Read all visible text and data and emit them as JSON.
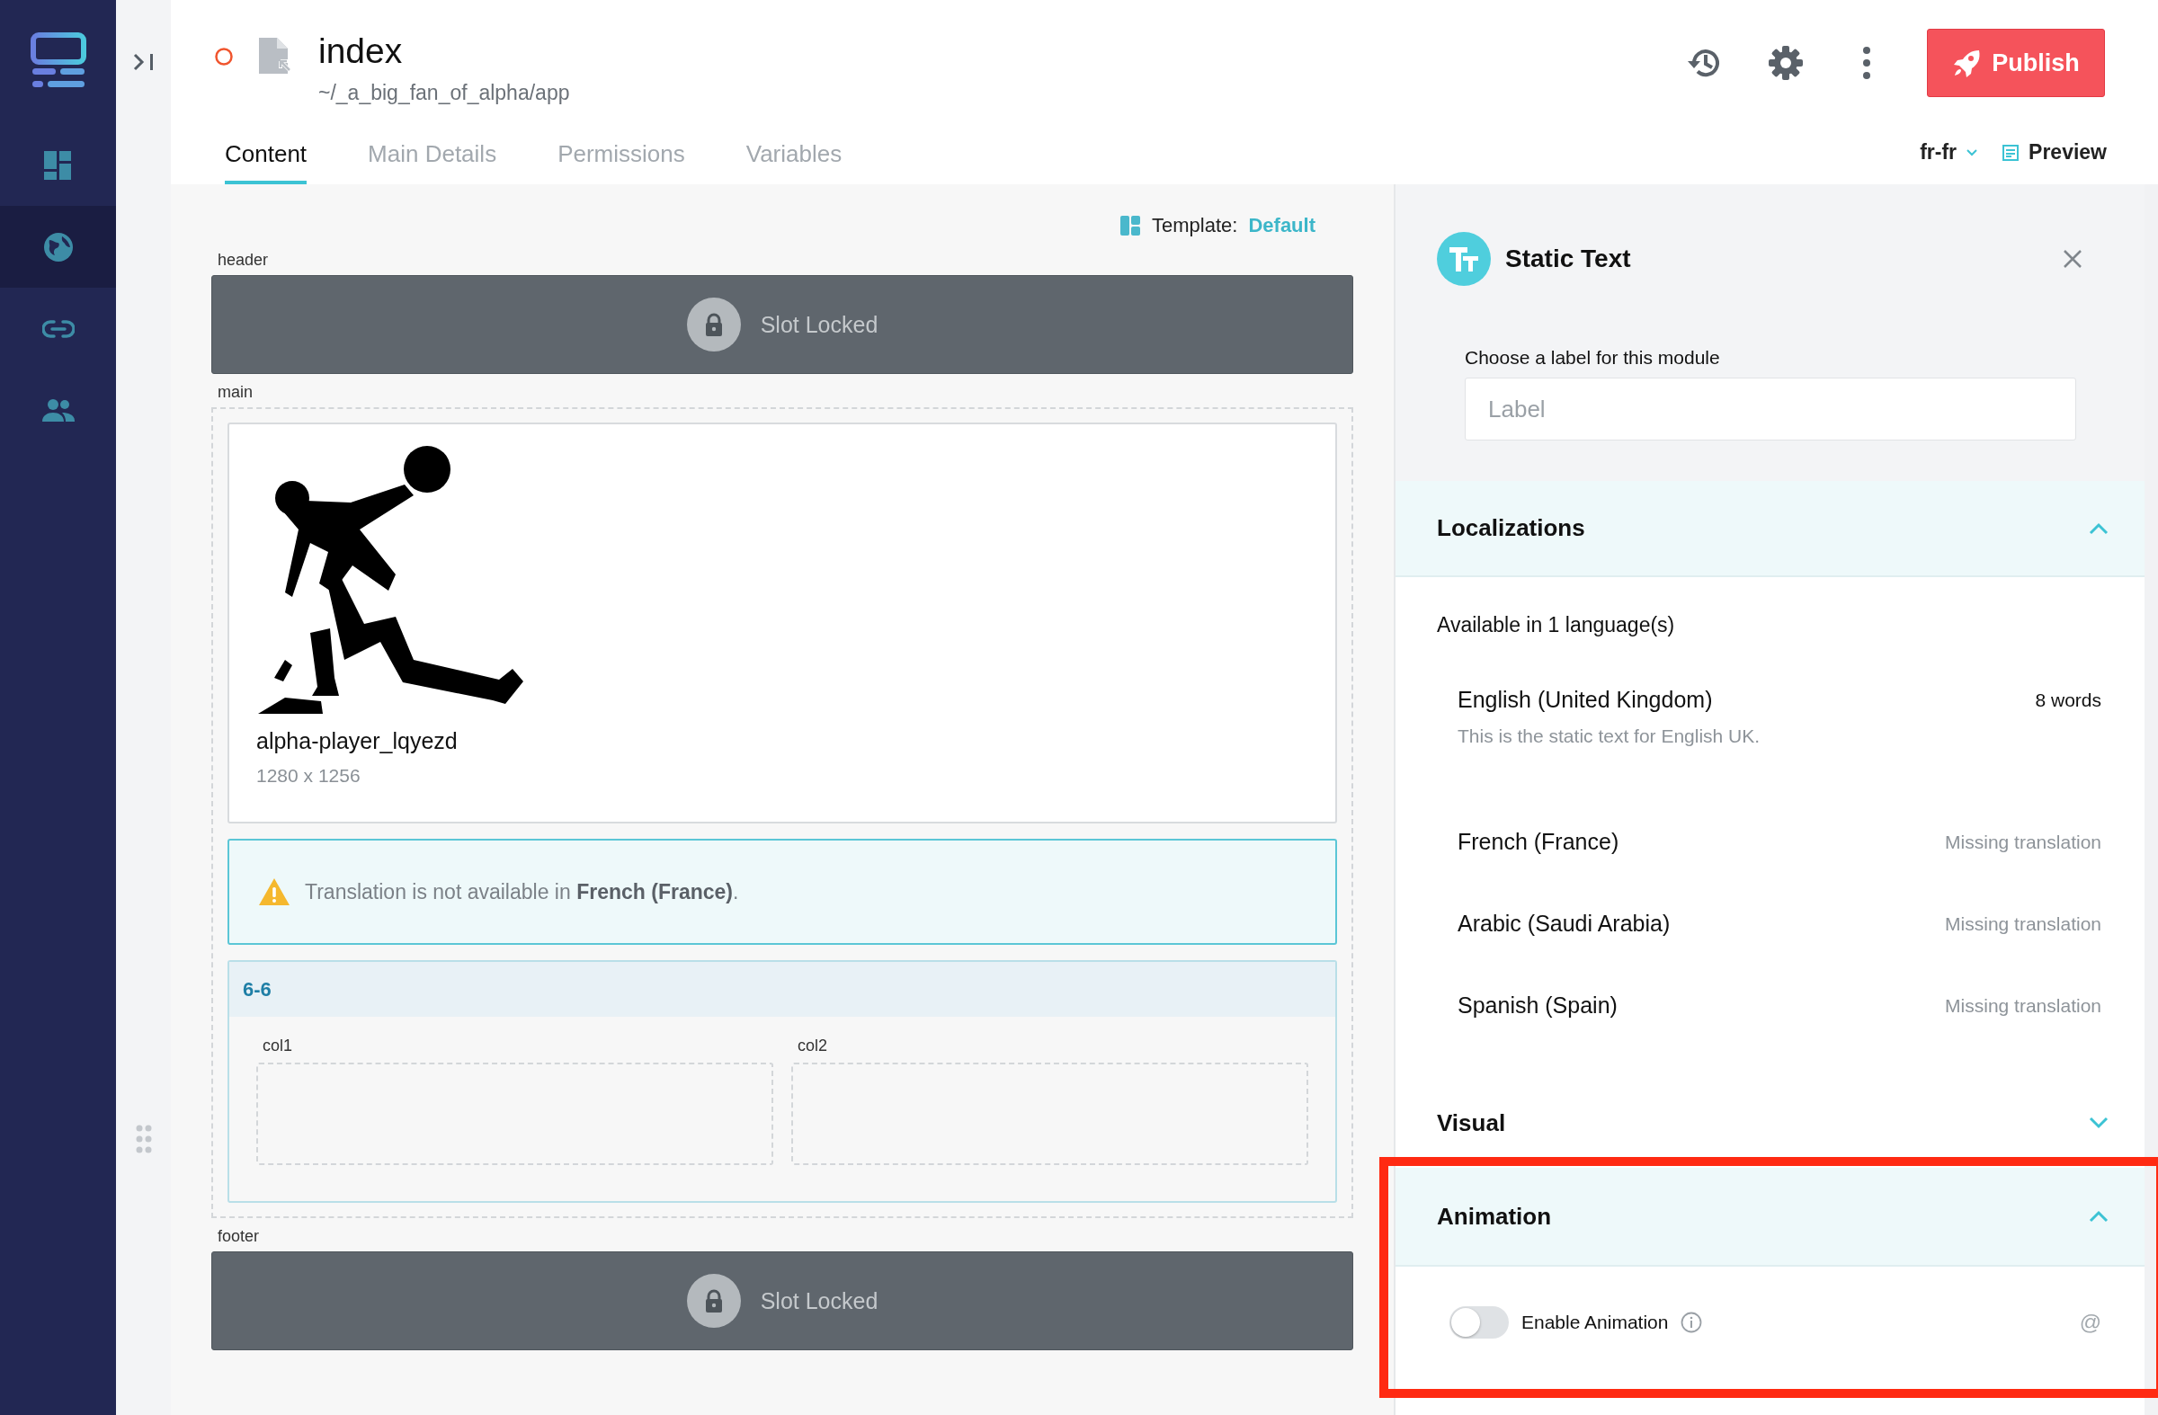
{
  "nav": {
    "items": [
      {
        "kind": "dashboard",
        "selected": false
      },
      {
        "kind": "globe",
        "selected": true
      },
      {
        "kind": "link",
        "selected": false
      },
      {
        "kind": "users",
        "selected": false
      }
    ]
  },
  "page": {
    "title": "index",
    "path": "~/_a_big_fan_of_alpha/app"
  },
  "tabs": [
    {
      "label": "Content",
      "selected": true
    },
    {
      "label": "Main Details",
      "selected": false
    },
    {
      "label": "Permissions",
      "selected": false
    },
    {
      "label": "Variables",
      "selected": false
    }
  ],
  "toolbar": {
    "publish": "Publish",
    "locale": "fr-fr",
    "preview": "Preview"
  },
  "canvas": {
    "template_label": "Template:",
    "template_name": "Default",
    "slots": [
      {
        "kind": "locked",
        "label": "header",
        "text": "Slot Locked"
      },
      {
        "kind": "content",
        "label": "main",
        "modules": [
          {
            "name": "alpha-player_lqyezd",
            "size": "1280 x 1256"
          },
          {
            "kind": "warning",
            "text": "Translation is not available in **French (France)**."
          },
          {
            "kind": "layout",
            "title": "6-6",
            "columns": [
              "col1",
              "col2"
            ]
          }
        ]
      },
      {
        "kind": "locked",
        "label": "footer",
        "text": "Slot Locked"
      }
    ]
  },
  "panel": {
    "title": "Static Text",
    "label_prompt": "Choose a label for this module",
    "label_placeholder": "Label",
    "sections": [
      {
        "kind": "localizations",
        "title": "Localizations",
        "expanded": true,
        "highlighted": false,
        "summary": "Available in 1 language(s)",
        "languages": [
          {
            "kind": "translated",
            "name": "English (United Kingdom)",
            "count": "8 words",
            "text": "This is the static text for English UK."
          },
          {
            "kind": "missing",
            "name": "French (France)",
            "status": "Missing translation"
          },
          {
            "kind": "missing",
            "name": "Arabic (Saudi Arabia)",
            "status": "Missing translation"
          },
          {
            "kind": "missing",
            "name": "Spanish (Spain)",
            "status": "Missing translation"
          }
        ]
      },
      {
        "kind": "visual",
        "title": "Visual",
        "expanded": false,
        "highlighted": false
      },
      {
        "kind": "animation",
        "title": "Animation",
        "expanded": true,
        "highlighted": true,
        "toggle": {
          "label": "Enable Animation",
          "on": false,
          "suffix": "@"
        }
      }
    ]
  }
}
